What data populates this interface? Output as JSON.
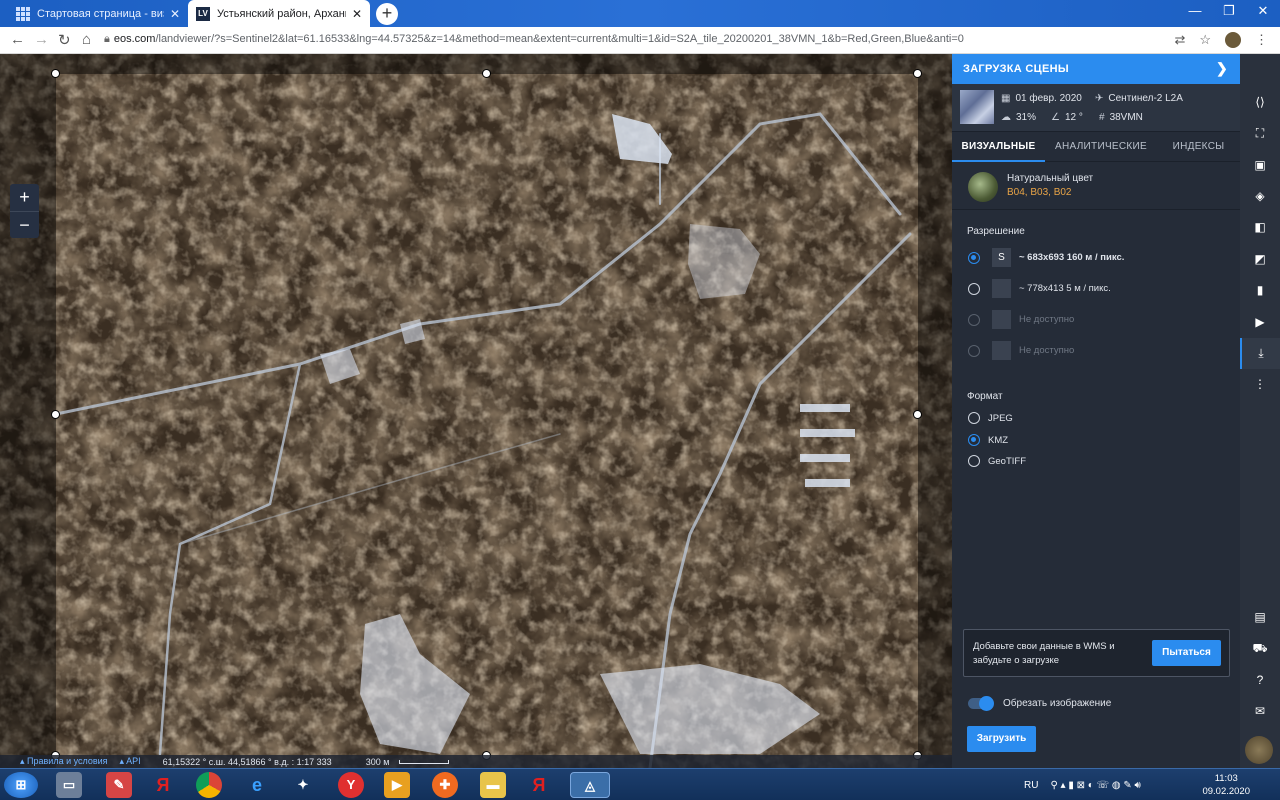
{
  "browser": {
    "tabs": [
      {
        "title": "Стартовая страница - визуальн",
        "active": false,
        "icon": "grid-icon"
      },
      {
        "title": "Устьянский район, Архангельск",
        "active": true,
        "icon": "lv-logo-icon",
        "icon_text": "LV"
      }
    ],
    "url_host": "eos.com",
    "url_path": "/landviewer/?s=Sentinel2&lat=61.16533&lng=44.57325&z=14&method=mean&extent=current&multi=1&id=S2A_tile_20200201_38VMN_1&b=Red,Green,Blue&anti=0"
  },
  "map": {
    "zoom_in": "+",
    "zoom_out": "−",
    "status": {
      "terms": "Правила и условия",
      "api": "API",
      "coords": "61,15322 ° с.ш. 44,51866 ° в.д.",
      "scale_num": "1:17 333",
      "scale_dist": "300 м"
    }
  },
  "panel": {
    "header": "ЗАГРУЗКА СЦЕНЫ",
    "scene": {
      "date": "01 февр. 2020",
      "satellite": "Сентинел-2 L2A",
      "cloud": "31%",
      "sun_angle": "12 °",
      "tile": "38VMN"
    },
    "tabs": [
      {
        "label": "ВИЗУАЛЬНЫЕ",
        "active": true
      },
      {
        "label": "АНАЛИТИЧЕСКИЕ",
        "active": false
      },
      {
        "label": "ИНДЕКСЫ",
        "active": false
      }
    ],
    "preset": {
      "name": "Натуральный цвет",
      "bands": "B04, B03, B02"
    },
    "resolution_title": "Разрешение",
    "resolutions": [
      {
        "badge": "S",
        "label": "~ 683x693 160 м / пикс.",
        "selected": true,
        "disabled": false
      },
      {
        "badge": "",
        "label": "~ 778x413 5 м / пикс.",
        "selected": false,
        "disabled": false
      },
      {
        "badge": "",
        "label": "Не доступно",
        "selected": false,
        "disabled": true
      },
      {
        "badge": "",
        "label": "Не доступно",
        "selected": false,
        "disabled": true
      }
    ],
    "format_title": "Формат",
    "formats": [
      {
        "label": "JPEG",
        "selected": false
      },
      {
        "label": "KMZ",
        "selected": true
      },
      {
        "label": "GeoTIFF",
        "selected": false
      }
    ],
    "wms_text": "Добавьте свои данные в WMS и забудьте о загрузке",
    "wms_button": "Пытаться",
    "crop_label": "Обрезать изображение",
    "crop_enabled": true,
    "download_button": "Загрузить"
  },
  "rail_icons": [
    "code-icon",
    "crop-icon",
    "image-icon",
    "layers-icon",
    "compare-icon",
    "split-icon",
    "chart-icon",
    "play-icon",
    "download-icon",
    "more-icon",
    "chat-icon",
    "cart-icon",
    "help-icon",
    "feedback-icon"
  ],
  "taskbar": {
    "lang": "RU",
    "time": "11:03",
    "date": "09.02.2020"
  },
  "colors": {
    "accent": "#2b8cef",
    "panel_bg": "#252c38",
    "bands": "#e8a447"
  }
}
